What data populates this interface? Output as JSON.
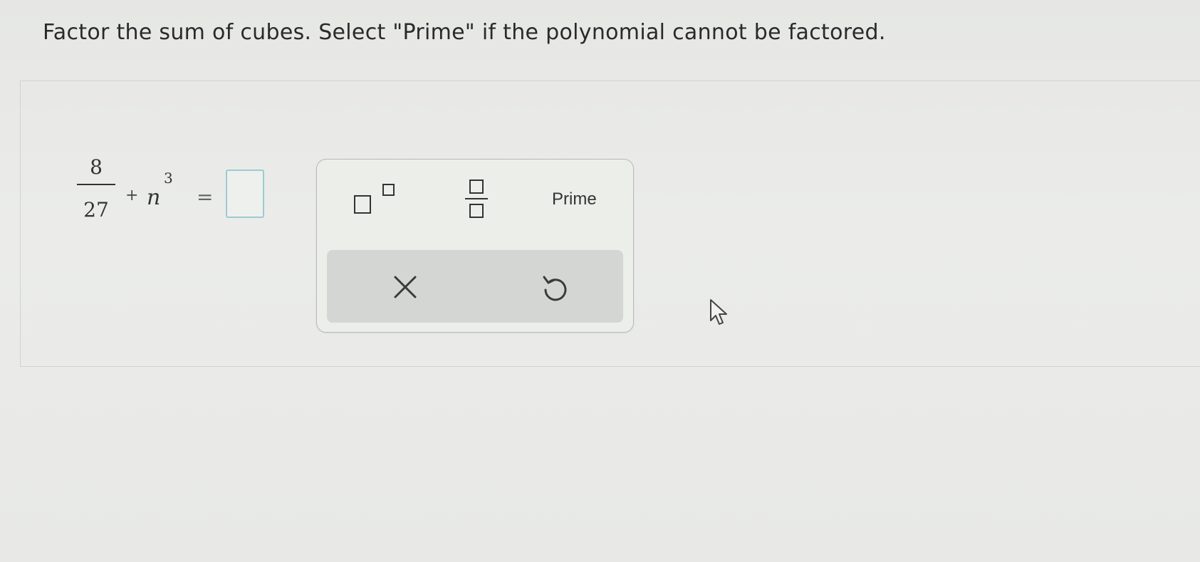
{
  "question": {
    "instruction": "Factor the sum of cubes. Select \"Prime\" if the polynomial cannot be factored."
  },
  "equation": {
    "numerator": "8",
    "denominator": "27",
    "plus": "+",
    "variable": "n",
    "exponent": "3",
    "equals": "=",
    "answer_value": ""
  },
  "palette": {
    "prime_label": "Prime",
    "icons": {
      "exponent": "exponent-template-icon",
      "fraction": "fraction-template-icon",
      "clear": "clear-x-icon",
      "undo": "undo-icon"
    }
  },
  "colors": {
    "answer_box_border": "#9ccbd1",
    "action_bar": "#d4d6d4",
    "background": "#e9eae7"
  }
}
